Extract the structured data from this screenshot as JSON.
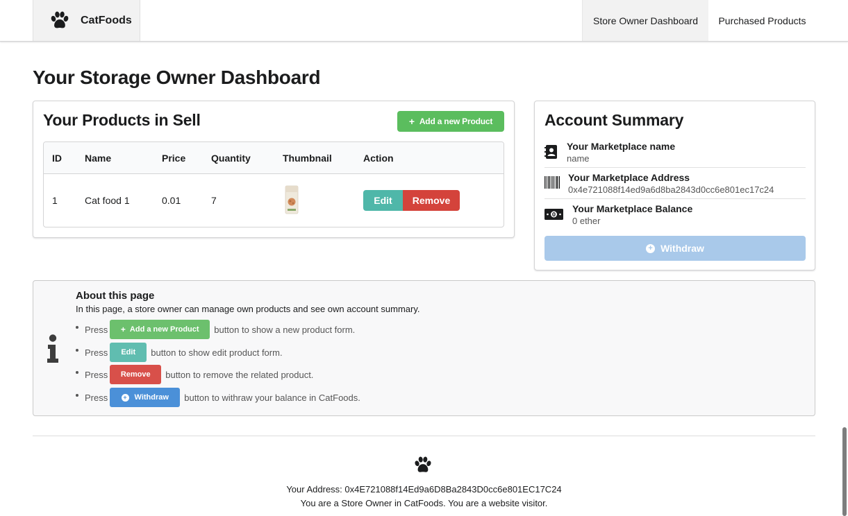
{
  "nav": {
    "brand": "CatFoods",
    "items": [
      "Store Owner Dashboard",
      "Purchased Products"
    ]
  },
  "page": {
    "title": "Your Storage Owner Dashboard"
  },
  "products": {
    "title": "Your Products in Sell",
    "add_label": "Add a new Product",
    "columns": [
      "ID",
      "Name",
      "Price",
      "Quantity",
      "Thumbnail",
      "Action"
    ],
    "rows": [
      {
        "id": "1",
        "name": "Cat food 1",
        "price": "0.01",
        "quantity": "7",
        "edit": "Edit",
        "remove": "Remove"
      }
    ]
  },
  "summary": {
    "title": "Account Summary",
    "name_head": "Your Marketplace name",
    "name_value": "name",
    "address_head": "Your Marketplace Address",
    "address_value": "0x4e721088f14ed9a6d8ba2843d0cc6e801ec17c24",
    "balance_head": "Your Marketplace Balance",
    "balance_value": "0 ether",
    "withdraw_label": "Withdraw"
  },
  "info": {
    "header": "About this page",
    "description": "In this page, a store owner can manage own products and see own account summary.",
    "items": [
      {
        "pre": "Press",
        "button": "Add a new Product",
        "post": "button to show a new product form."
      },
      {
        "pre": "Press",
        "button": "Edit",
        "post": "button to show edit product form."
      },
      {
        "pre": "Press",
        "button": "Remove",
        "post": "button to remove the related product."
      },
      {
        "pre": "Press",
        "button": "Withdraw",
        "post": "button to withraw your balance in CatFoods."
      }
    ]
  },
  "footer": {
    "address_line": "Your Address: 0x4E721088f14Ed9a6D8Ba2843D0cc6e801EC17C24",
    "role_line": "You are a Store Owner in CatFoods. You are a website visitor."
  },
  "colors": {
    "green": "#5bbd5e",
    "teal": "#4fb7a9",
    "red": "#d4433b",
    "blue": "#4b90d8",
    "blue_disabled": "#a9c9ea"
  }
}
